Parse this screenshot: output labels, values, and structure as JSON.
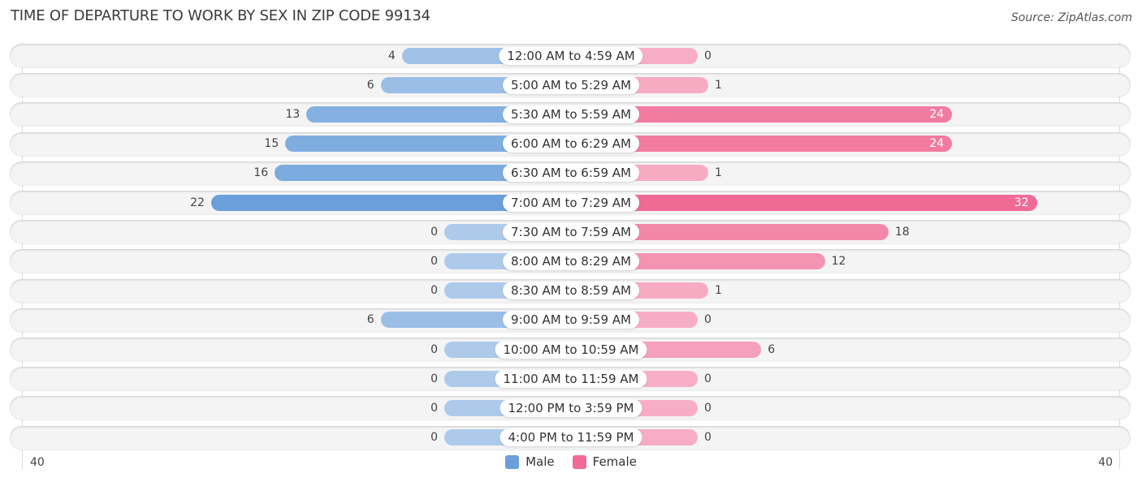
{
  "chart_data": {
    "type": "bar",
    "orientation": "horizontal-diverging",
    "title": "TIME OF DEPARTURE TO WORK BY SEX IN ZIP CODE 99134",
    "source": "Source: ZipAtlas.com",
    "categories": [
      "12:00 AM to 4:59 AM",
      "5:00 AM to 5:29 AM",
      "5:30 AM to 5:59 AM",
      "6:00 AM to 6:29 AM",
      "6:30 AM to 6:59 AM",
      "7:00 AM to 7:29 AM",
      "7:30 AM to 7:59 AM",
      "8:00 AM to 8:29 AM",
      "8:30 AM to 8:59 AM",
      "9:00 AM to 9:59 AM",
      "10:00 AM to 10:59 AM",
      "11:00 AM to 11:59 AM",
      "12:00 PM to 3:59 PM",
      "4:00 PM to 11:59 PM"
    ],
    "series": [
      {
        "name": "Male",
        "color": "#6a9fdb",
        "values": [
          4,
          6,
          13,
          15,
          16,
          22,
          0,
          0,
          0,
          6,
          0,
          0,
          0,
          0
        ]
      },
      {
        "name": "Female",
        "color": "#f06a95",
        "values": [
          0,
          1,
          24,
          24,
          1,
          32,
          18,
          12,
          1,
          0,
          6,
          0,
          0,
          0
        ]
      }
    ],
    "axis": {
      "left_tick": "40",
      "right_tick": "40",
      "range": [
        -40,
        40
      ]
    },
    "legend": {
      "position": "bottom-center",
      "items": [
        "Male",
        "Female"
      ]
    },
    "grid": false
  }
}
